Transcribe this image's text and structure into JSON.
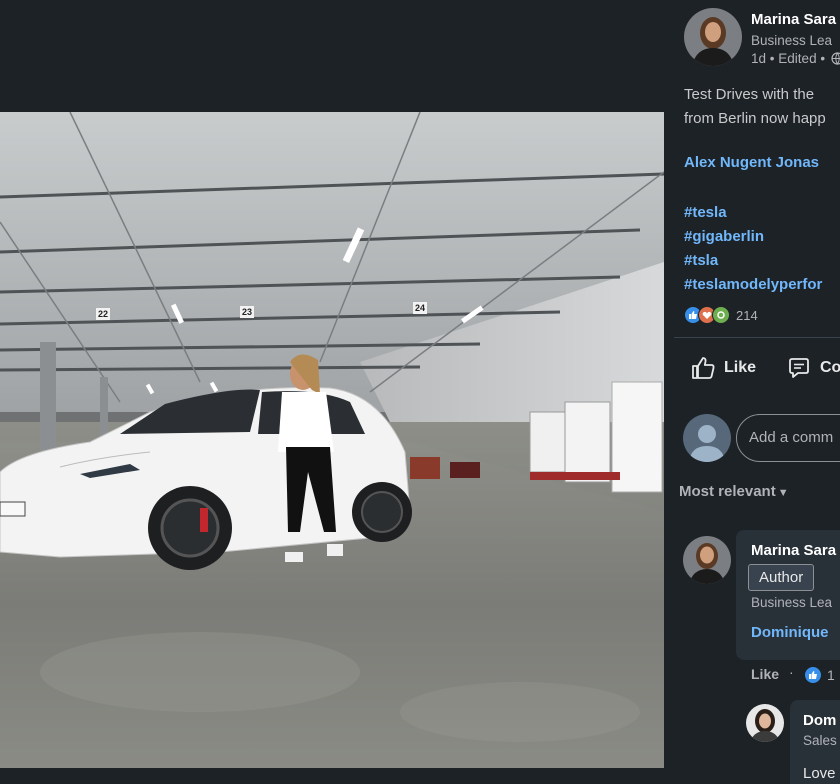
{
  "post": {
    "author": {
      "name": "Marina Sara",
      "title": "Business Lea",
      "time": "1d",
      "edited": "Edited",
      "meta_sep": "•"
    },
    "text_line1": "Test Drives with the",
    "text_line2": "from Berlin now happ",
    "mentions": "Alex Nugent Jonas",
    "hashtags": [
      "#tesla",
      "#gigaberlin",
      "#tsla",
      "#teslamodelyperfor"
    ],
    "reaction_count": "214",
    "reaction_icons": [
      "like-icon",
      "love-icon",
      "support-icon"
    ]
  },
  "photo": {
    "parking_numbers": [
      "22",
      "23",
      "24"
    ]
  },
  "actions": {
    "like": "Like",
    "comment": "Co"
  },
  "comment_input": {
    "placeholder": "Add a comm"
  },
  "sort": {
    "label": "Most relevant"
  },
  "comment": {
    "author": "Marina Sara",
    "badge": "Author",
    "title": "Business Lea",
    "mention": "Dominique",
    "like": "Like",
    "separator": "·",
    "reaction_count": "1"
  },
  "reply": {
    "author": "Dom",
    "title": "Sales",
    "text": "Love"
  },
  "colors": {
    "background": "#1d2226",
    "link": "#71b7fb",
    "bubble": "#293138",
    "like_blue": "#378fe9",
    "love_red": "#df704d",
    "support_green": "#6dae4f"
  }
}
